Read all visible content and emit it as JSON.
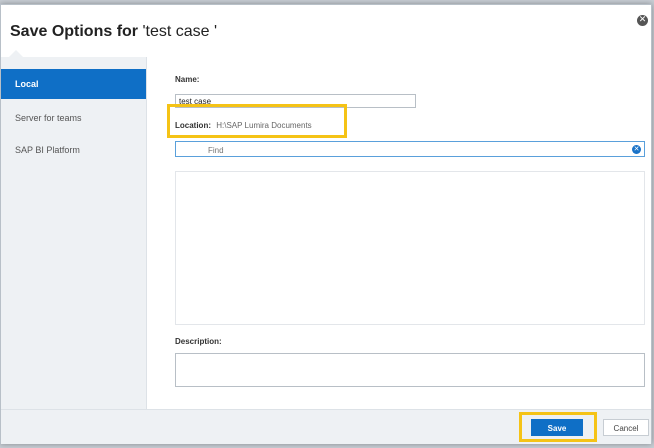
{
  "dialog": {
    "title_bold": "Save Options for",
    "title_name": "'test case '"
  },
  "sidebar": {
    "items": [
      {
        "label": "Local",
        "active": true
      },
      {
        "label": "Server for teams",
        "active": false
      },
      {
        "label": "SAP BI Platform",
        "active": false
      }
    ]
  },
  "form": {
    "name_label": "Name:",
    "name_value": "test case",
    "location_label": "Location:",
    "location_value": "H:\\SAP Lumira Documents",
    "find_placeholder": "Find",
    "description_label": "Description:",
    "description_value": ""
  },
  "footer": {
    "save_label": "Save",
    "cancel_label": "Cancel"
  },
  "colors": {
    "accent": "#0f6fc6",
    "highlight": "#f5c316",
    "sidebar_bg": "#eef1f4"
  }
}
